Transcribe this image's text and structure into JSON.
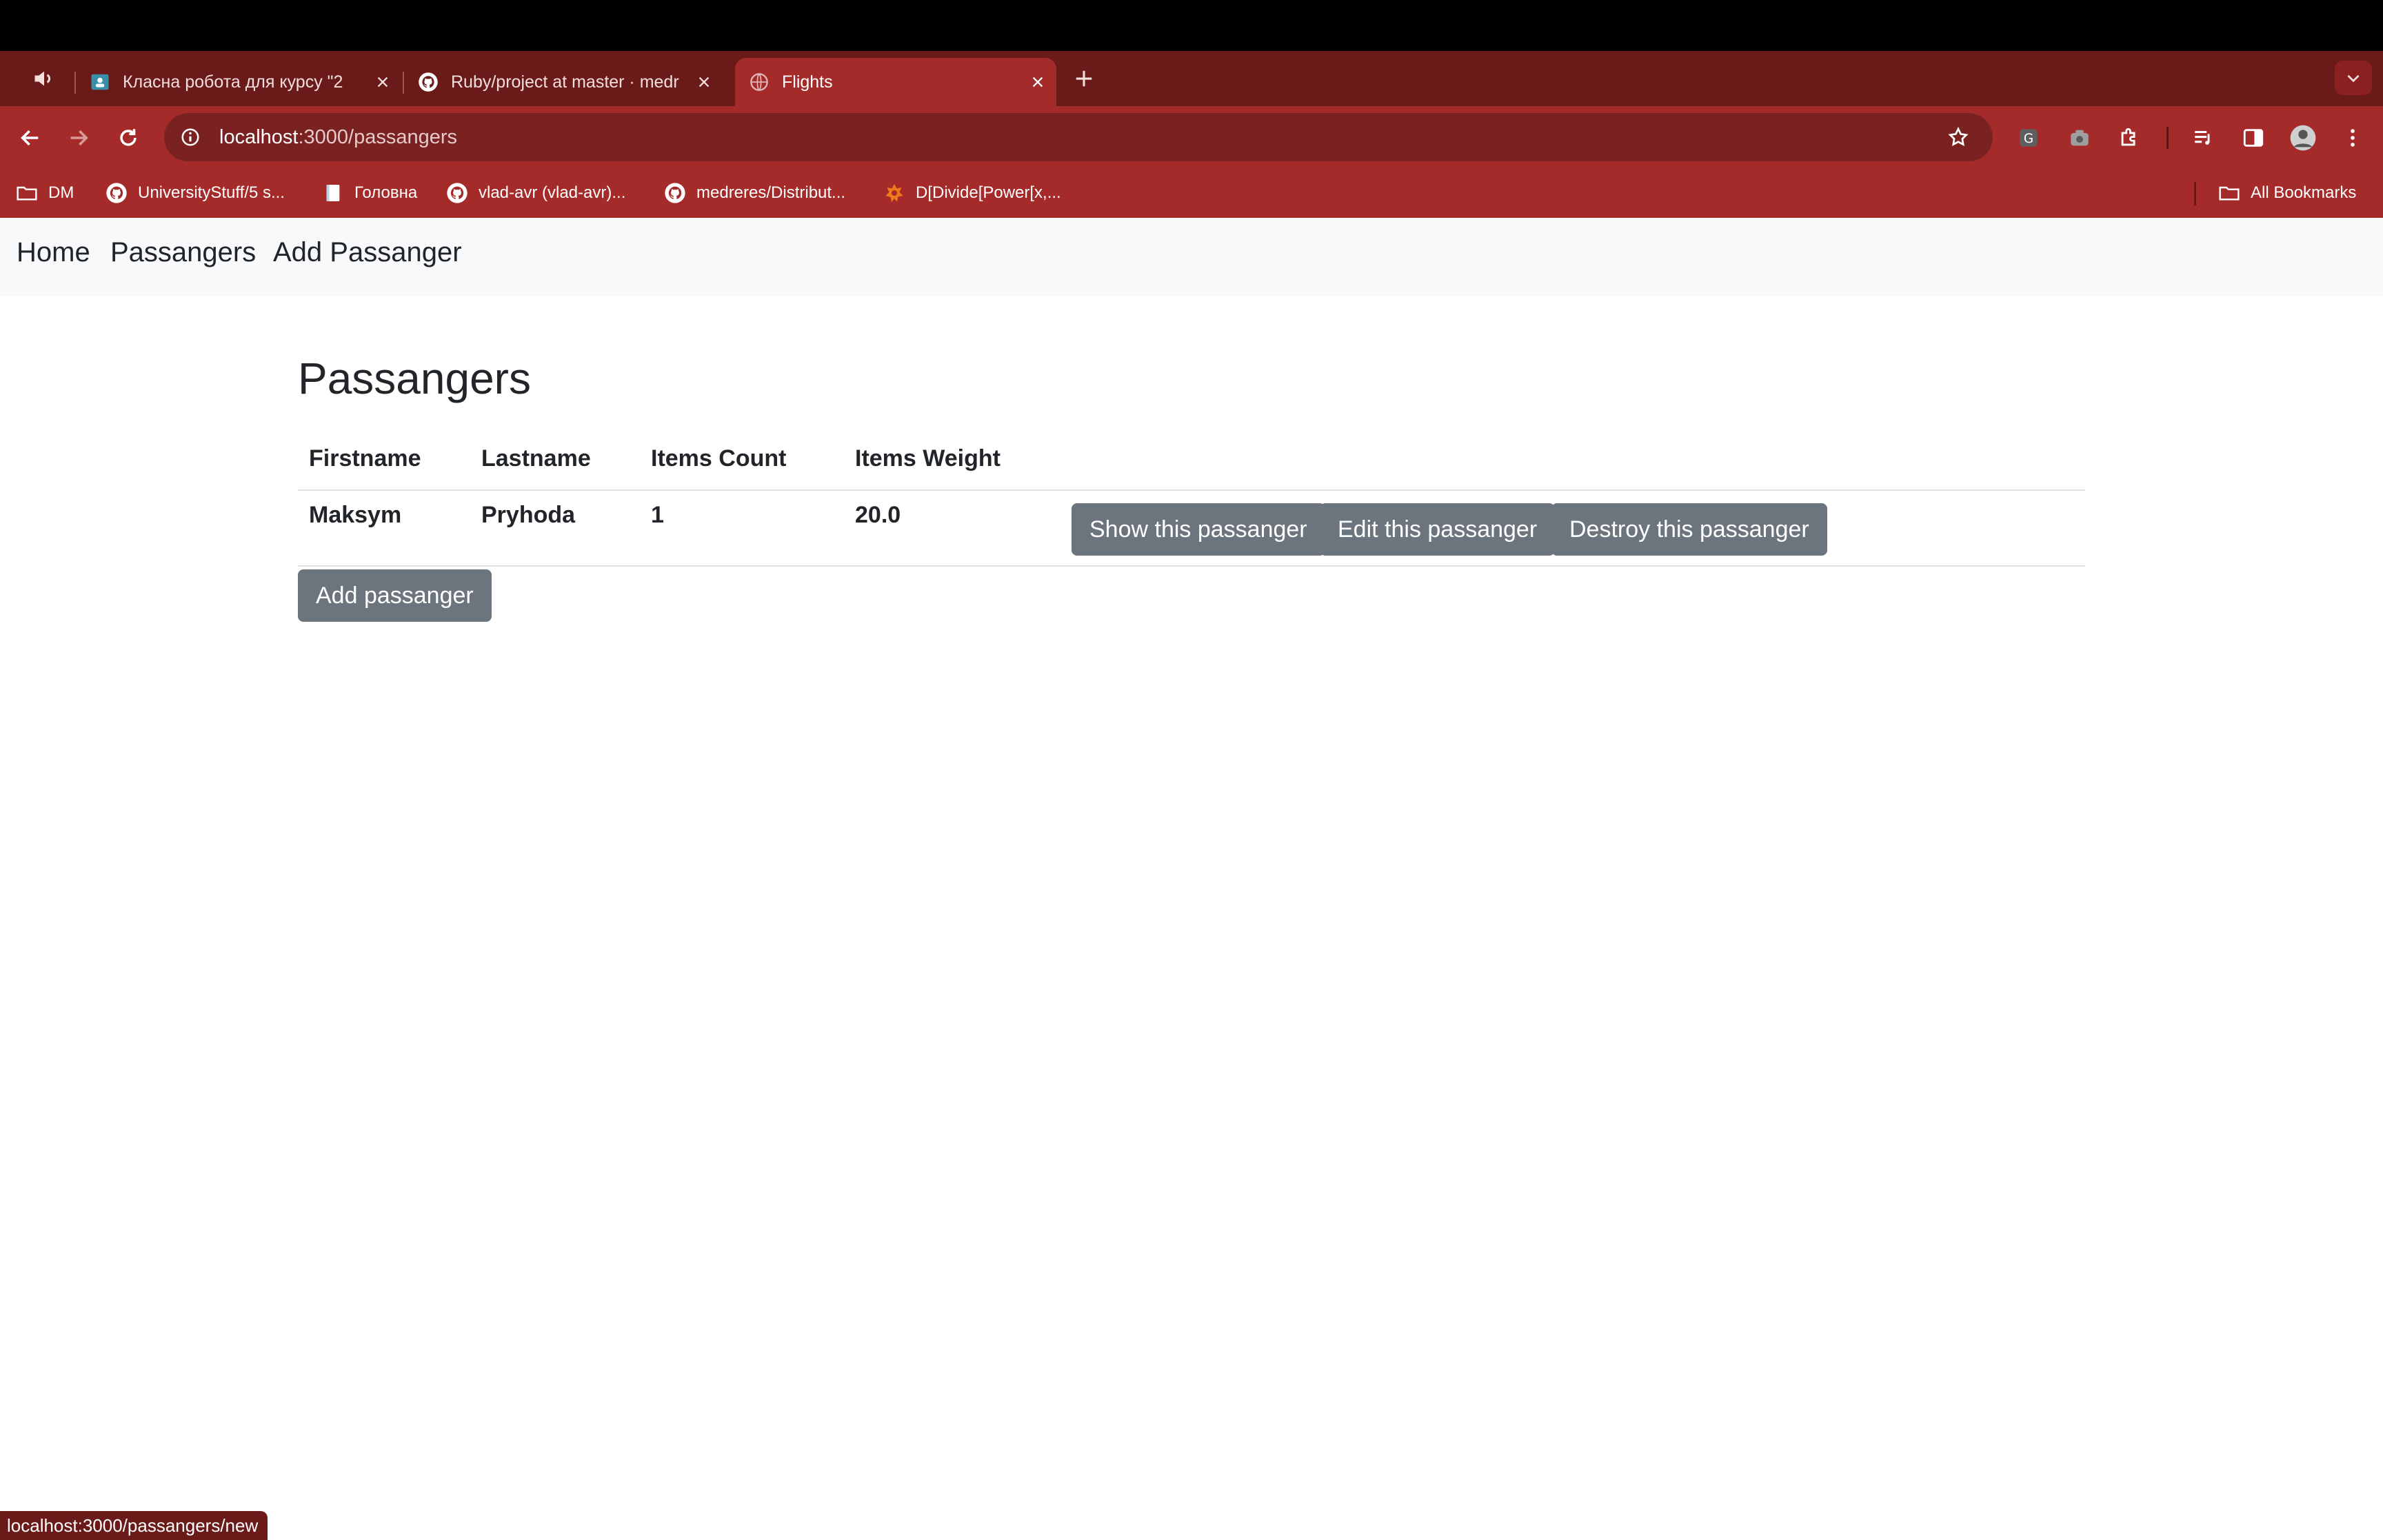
{
  "browser": {
    "tabs": [
      {
        "title": "Класна робота для курсу \"2",
        "active": false
      },
      {
        "title": "Ruby/project at master · medr",
        "active": false
      },
      {
        "title": "Flights",
        "active": true
      }
    ],
    "url_host": "localhost",
    "url_path": ":3000/passangers",
    "bookmarks": [
      {
        "label": "DM",
        "icon": "folder-icon"
      },
      {
        "label": "UniversityStuff/5 s...",
        "icon": "github-icon"
      },
      {
        "label": "Головна",
        "icon": "notebook-icon"
      },
      {
        "label": "vlad-avr (vlad-avr)...",
        "icon": "github-icon"
      },
      {
        "label": "medreres/Distribut...",
        "icon": "github-icon"
      },
      {
        "label": "D[Divide[Power[x,...",
        "icon": "wolfram-icon"
      }
    ],
    "all_bookmarks": "All Bookmarks",
    "status_url": "localhost:3000/passangers/new",
    "theme_color": "#a52a2a"
  },
  "nav": {
    "home": "Home",
    "passangers": "Passangers",
    "add_passanger": "Add Passanger"
  },
  "page": {
    "title": "Passangers",
    "columns": [
      "Firstname",
      "Lastname",
      "Items Count",
      "Items Weight"
    ],
    "rows": [
      {
        "firstname": "Maksym",
        "lastname": "Pryhoda",
        "items_count": "1",
        "items_weight": "20.0"
      }
    ],
    "actions": {
      "show": "Show this passanger",
      "edit": "Edit this passanger",
      "destroy": "Destroy this passanger"
    },
    "add_button": "Add passanger",
    "button_color": "#6c757d"
  }
}
